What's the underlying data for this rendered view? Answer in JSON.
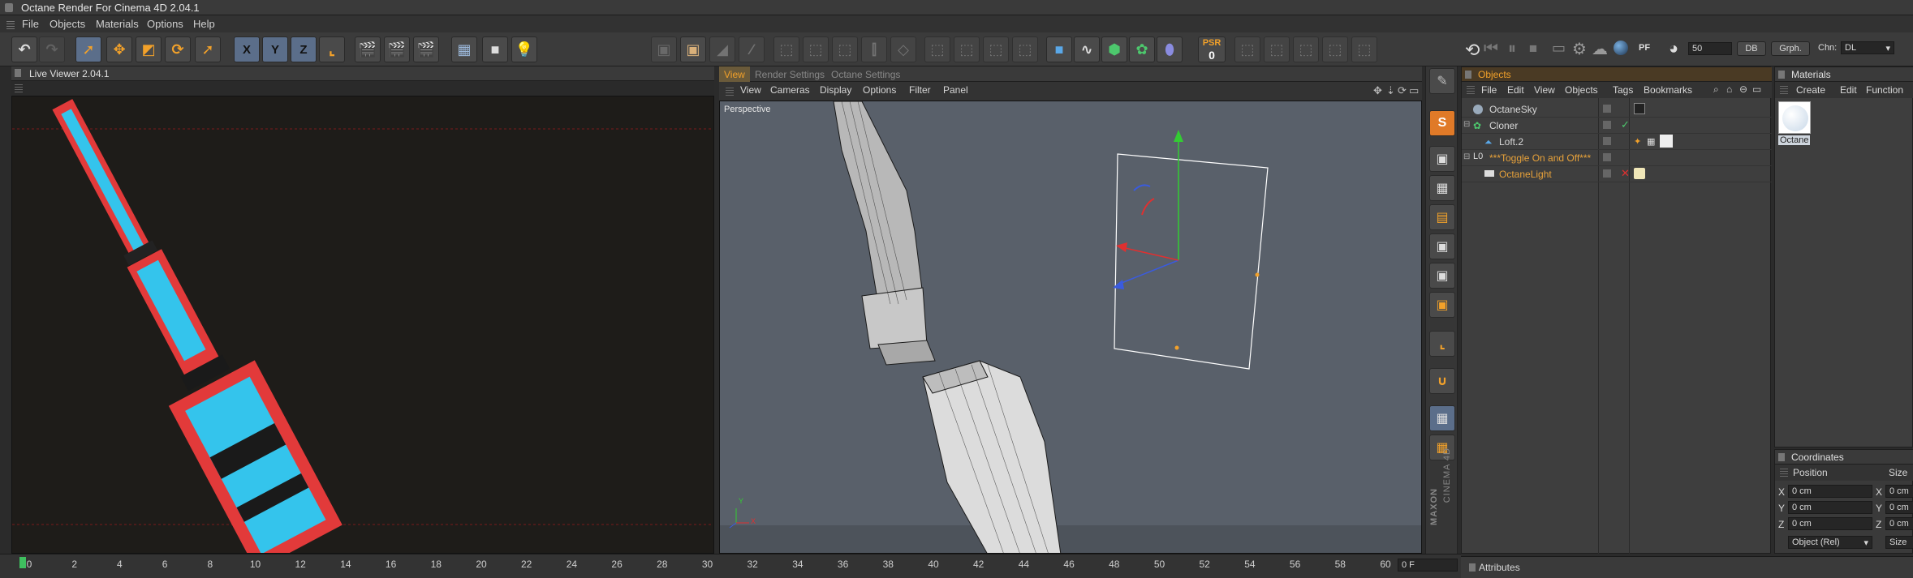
{
  "window": {
    "title": "Octane Render For Cinema 4D 2.04.1"
  },
  "menu": {
    "items": [
      "File",
      "Objects",
      "Materials",
      "Options",
      "Help"
    ]
  },
  "toolbar": {
    "axis_x": "X",
    "axis_y": "Y",
    "axis_z": "Z",
    "psr_label": "PSR",
    "psr_value": "0",
    "pf_label": "PF",
    "iterations_value": "50",
    "db_label": "DB",
    "graph_label": "Grph.",
    "chn_label": "Chn:",
    "chn_value": "DL"
  },
  "live_viewer": {
    "title": "Live Viewer 2.04.1"
  },
  "viewport": {
    "tabs": [
      "View",
      "Render Settings",
      "Octane Settings"
    ],
    "menu": [
      "View",
      "Cameras",
      "Display",
      "Options",
      "Filter",
      "Panel"
    ],
    "label": "Perspective",
    "axis_y": "Y",
    "axis_x": "X"
  },
  "objects_panel": {
    "title": "Objects",
    "menu": [
      "File",
      "Edit",
      "View",
      "Objects",
      "Tags",
      "Bookmarks"
    ],
    "rows": [
      {
        "name": "OctaneSky",
        "color": "#d8d8d8"
      },
      {
        "name": "Cloner",
        "color": "#d8d8d8"
      },
      {
        "name": "Loft.2",
        "color": "#d8d8d8"
      },
      {
        "name": "***Toggle On and Off***",
        "color": "#e8a23a"
      },
      {
        "name": "OctaneLight",
        "color": "#e8a23a"
      }
    ]
  },
  "materials_panel": {
    "title": "Materials",
    "menu": [
      "Create",
      "Edit",
      "Function"
    ],
    "material_name": "Octane"
  },
  "coordinates_panel": {
    "title": "Coordinates",
    "position_label": "Position",
    "size_label": "Size",
    "axes": [
      "X",
      "Y",
      "Z"
    ],
    "values": [
      "0 cm",
      "0 cm",
      "0 cm"
    ],
    "size_values": [
      "0 cm",
      "0 cm",
      "0 cm"
    ],
    "mode": "Object (Rel)",
    "size_button": "Size"
  },
  "timeline": {
    "labels": [
      "0",
      "2",
      "4",
      "6",
      "8",
      "10",
      "12",
      "14",
      "16",
      "18",
      "20",
      "22",
      "24",
      "26",
      "28",
      "30",
      "32",
      "34",
      "36",
      "38",
      "40",
      "42",
      "44",
      "46",
      "48",
      "50",
      "52",
      "54",
      "56",
      "58",
      "60"
    ],
    "frame_field": "0 F"
  },
  "attributes_panel": {
    "title": "Attributes"
  },
  "brand": {
    "line1": "MAXON",
    "line2": "CINEMA 4D"
  }
}
